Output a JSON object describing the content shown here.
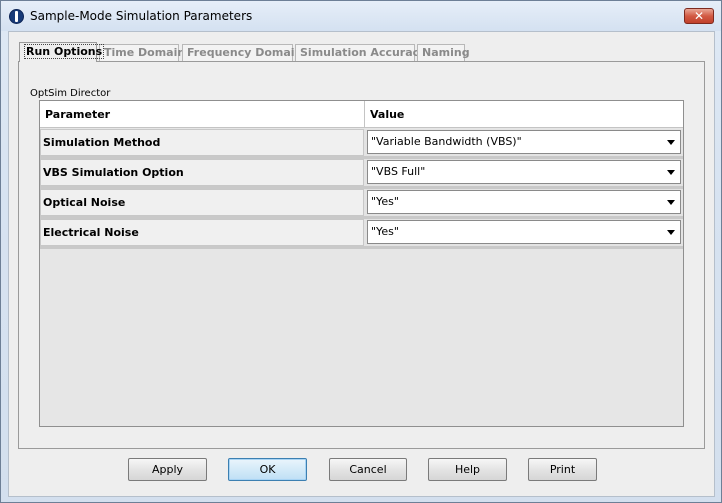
{
  "window": {
    "title": "Sample-Mode Simulation Parameters",
    "close_label": "✕"
  },
  "tabs": [
    {
      "label": "Run Options",
      "active": true
    },
    {
      "label": "Time Domain",
      "active": false
    },
    {
      "label": "Frequency Domain",
      "active": false
    },
    {
      "label": "Simulation Accuracy",
      "active": false
    },
    {
      "label": "Naming",
      "active": false
    }
  ],
  "panel": {
    "group_label": "OptSim Director",
    "columns": {
      "parameter": "Parameter",
      "value": "Value"
    },
    "rows": [
      {
        "parameter": "Simulation Method",
        "value": "\"Variable Bandwidth (VBS)\""
      },
      {
        "parameter": "VBS Simulation Option",
        "value": "\"VBS Full\""
      },
      {
        "parameter": "Optical Noise",
        "value": "\"Yes\""
      },
      {
        "parameter": "Electrical Noise",
        "value": "\"Yes\""
      }
    ]
  },
  "buttons": {
    "apply": "Apply",
    "ok": "OK",
    "cancel": "Cancel",
    "help": "Help",
    "print": "Print"
  }
}
